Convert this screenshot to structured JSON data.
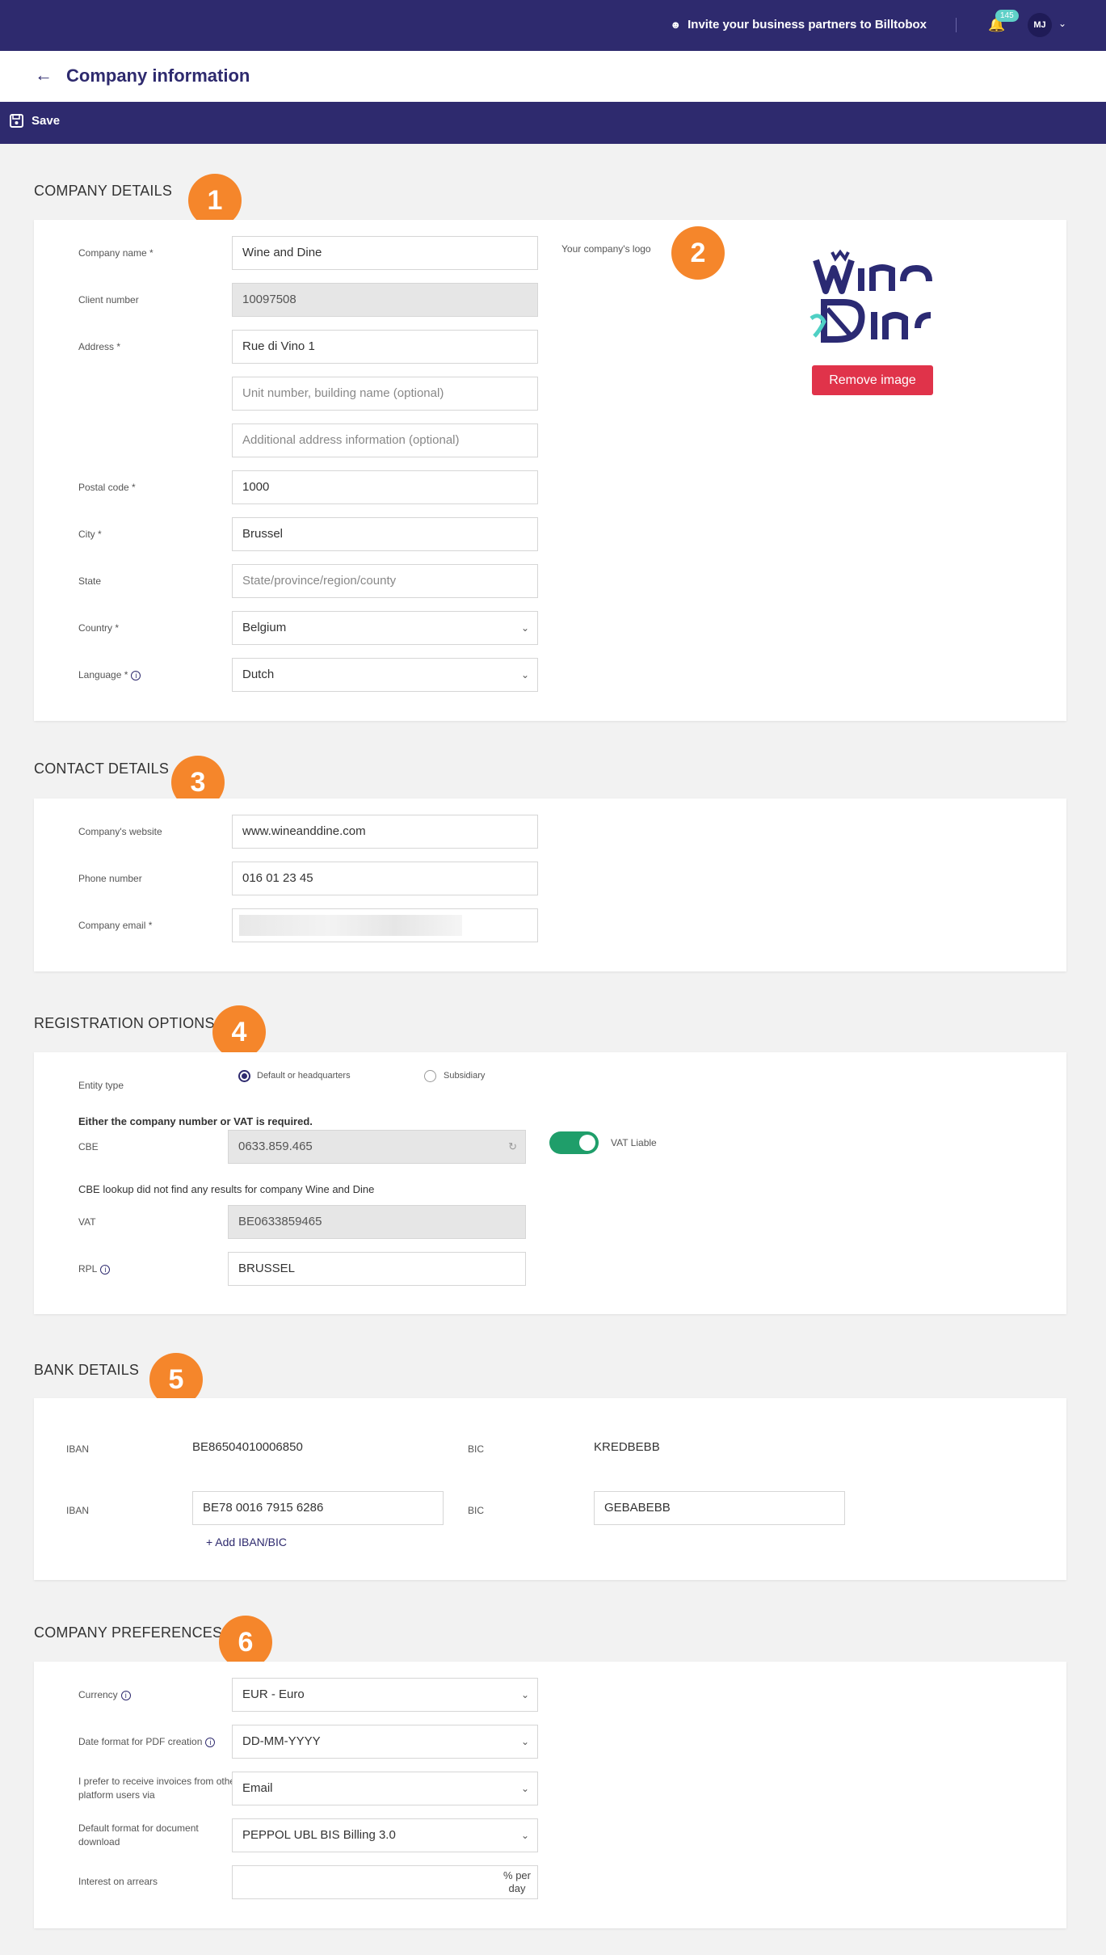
{
  "topbar": {
    "invite_label": "Invite your business partners to Billtobox",
    "notification_count": "145",
    "avatar_initials": "MJ"
  },
  "header": {
    "title": "Company information"
  },
  "toolbar": {
    "save_label": "Save"
  },
  "company_details": {
    "title": "COMPANY DETAILS",
    "marker": "1",
    "company_name_label": "Company name *",
    "company_name": "Wine and Dine",
    "client_number_label": "Client number",
    "client_number": "10097508",
    "address_label": "Address *",
    "address": "Rue di Vino 1",
    "address2_placeholder": "Unit number, building name (optional)",
    "address3_placeholder": "Additional address information (optional)",
    "postal_label": "Postal code *",
    "postal": "1000",
    "city_label": "City *",
    "city": "Brussel",
    "state_label": "State",
    "state_placeholder": "State/province/region/county",
    "country_label": "Country *",
    "country": "Belgium",
    "language_label": "Language *",
    "language": "Dutch",
    "logo_label": "Your company's logo",
    "logo_marker": "2",
    "remove_image_label": "Remove image"
  },
  "contact_details": {
    "title": "CONTACT DETAILS",
    "marker": "3",
    "website_label": "Company's website",
    "website": "www.wineanddine.com",
    "phone_label": "Phone number",
    "phone": "016 01 23 45",
    "email_label": "Company email *"
  },
  "registration": {
    "title": "REGISTRATION OPTIONS",
    "marker": "4",
    "entity_type_label": "Entity type",
    "option_default": "Default or headquarters",
    "option_subsidiary": "Subsidiary",
    "required_note": "Either the company number or VAT is required.",
    "cbe_label": "CBE",
    "cbe": "0633.859.465",
    "vat_liable_label": "VAT Liable",
    "cbe_lookup_note": "CBE lookup did not find any results for company Wine and Dine",
    "vat_label": "VAT",
    "vat": "BE0633859465",
    "rpl_label": "RPL",
    "rpl": "BRUSSEL"
  },
  "bank": {
    "title": "BANK DETAILS",
    "marker": "5",
    "rows": [
      {
        "iban_label": "IBAN",
        "iban": "BE86504010006850",
        "bic_label": "BIC",
        "bic": "KREDBEBB"
      },
      {
        "iban_label": "IBAN",
        "iban": "BE78 0016 7915 6286",
        "bic_label": "BIC",
        "bic": "GEBABEBB"
      }
    ],
    "add_link": "+ Add IBAN/BIC"
  },
  "preferences": {
    "title": "COMPANY PREFERENCES",
    "marker": "6",
    "currency_label": "Currency",
    "currency": "EUR - Euro",
    "date_format_label": "Date format for PDF creation",
    "date_format": "DD-MM-YYYY",
    "receive_label_1": "I prefer to receive invoices from other",
    "receive_label_2": "platform users via",
    "receive": "Email",
    "download_label_1": "Default format for document",
    "download_label_2": "download",
    "download": "PEPPOL UBL BIS Billing 3.0",
    "interest_label": "Interest on arrears",
    "interest_unit_1": "% per",
    "interest_unit_2": "day"
  },
  "colors": {
    "brand": "#2e2a6e",
    "accent": "#f5862b",
    "danger": "#e0334a",
    "success": "#1f9e6a"
  }
}
